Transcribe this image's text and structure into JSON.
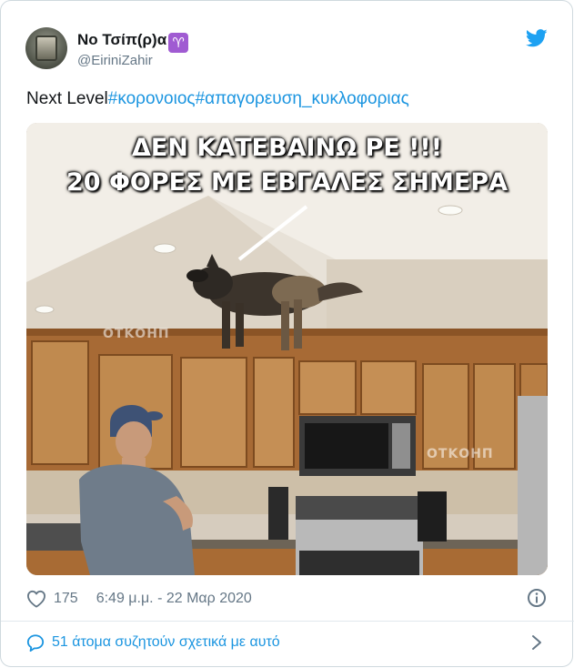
{
  "author": {
    "display_name": "No Τσίπ(ρ)α",
    "zodiac": "♈",
    "handle": "@EiriniZahir"
  },
  "tweet": {
    "text_prefix": "Next Level",
    "hashtags": [
      "#κορονοιος",
      "#απαγορευση_κυκλοφοριας"
    ]
  },
  "media": {
    "caption_line1": "ΔΕΝ ΚΑΤΕΒΑΙΝΩ ΡΕ !!!",
    "caption_line2": "20 ΦΟΡΕΣ ΜΕ ΕΒΓΑΛΕΣ ΣΗΜΕΡΑ",
    "watermark": "ΟΤΚΟΗΠ"
  },
  "meta": {
    "likes": "175",
    "timestamp": "6:49 μ.μ. - 22 Μαρ 2020"
  },
  "footer": {
    "conversation": "51 άτομα συζητούν σχετικά με αυτό"
  },
  "colors": {
    "link": "#1b95e0",
    "muted": "#657786",
    "text": "#14171a",
    "twitter_blue": "#1da1f2"
  },
  "icons": [
    "twitter-bird-icon",
    "heart-icon",
    "info-icon",
    "reply-bubble-icon",
    "chevron-right-icon"
  ]
}
